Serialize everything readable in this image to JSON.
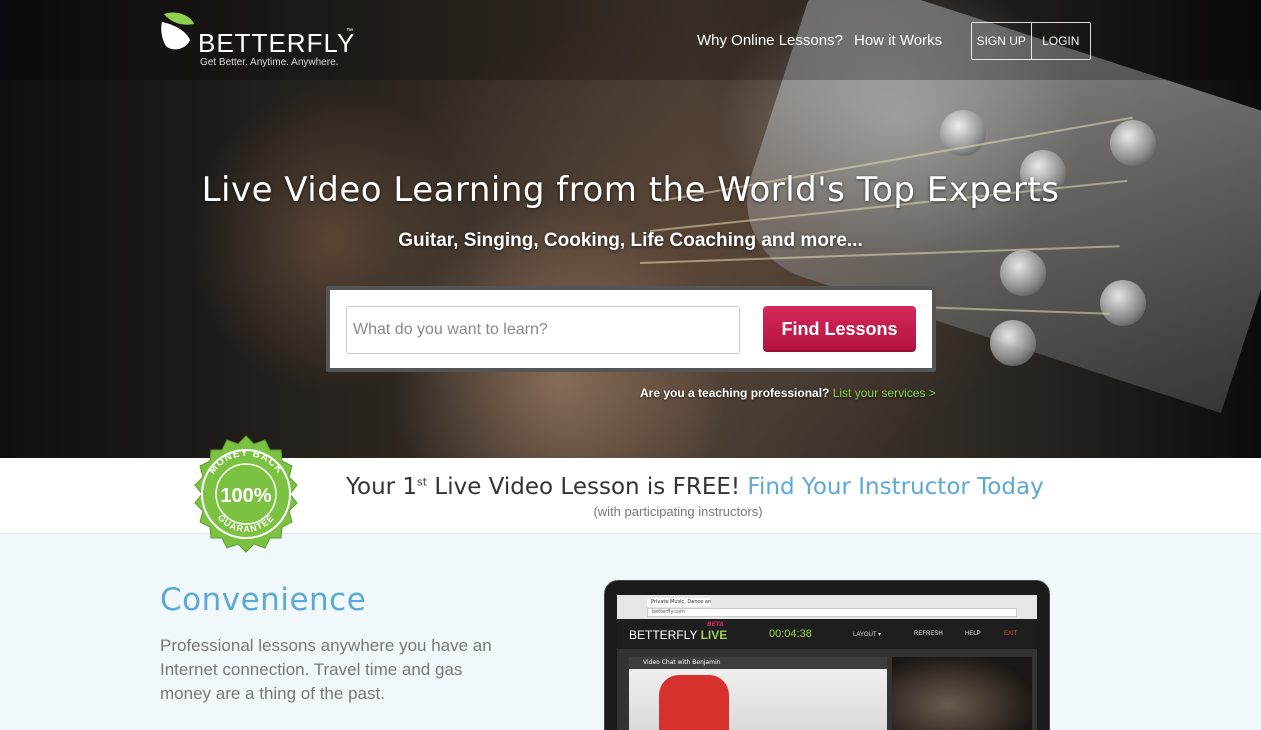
{
  "brand": {
    "name": "BETTERFLY",
    "trademark": "™",
    "tagline": "Get Better. Anytime. Anywhere.",
    "colors": {
      "green": "#8fd14f",
      "accent_red": "#c8184a",
      "blue": "#5aa9d6"
    }
  },
  "nav": {
    "why": "Why Online Lessons?",
    "how": "How it Works",
    "signup": "SIGN UP",
    "login": "LOGIN"
  },
  "hero": {
    "headline": "Live Video Learning from the World's Top Experts",
    "subheadline": "Guitar, Singing, Cooking, Life Coaching and more...",
    "search_placeholder": "What do you want to learn?",
    "search_value": "",
    "find_button": "Find Lessons",
    "teach_prompt": "Are you a teaching professional?",
    "teach_link": "List your services >"
  },
  "promo": {
    "badge_top": "MONEY BACK",
    "badge_center": "100%",
    "badge_bottom": "GUARANTEE",
    "line_start": "Your 1",
    "line_sup": "st",
    "line_middle": " Live Video Lesson is FREE! ",
    "line_cta": "Find Your Instructor Today",
    "note": "(with participating instructors)"
  },
  "convenience": {
    "title": "Convenience",
    "text": "Professional lessons anywhere you have an Internet connection. Travel time and gas money are a thing of the past."
  },
  "app_preview": {
    "tab": "Private Music, Dance and",
    "url": "betterfly.com",
    "logo": "BETTERFLY",
    "live": "LIVE",
    "beta": "BETA",
    "timer": "00:04:38",
    "layout": "LAYOUT ▾",
    "refresh": "REFRESH",
    "help": "HELP",
    "exit": "EXIT",
    "video_label": "Video Chat with Benjamin"
  }
}
